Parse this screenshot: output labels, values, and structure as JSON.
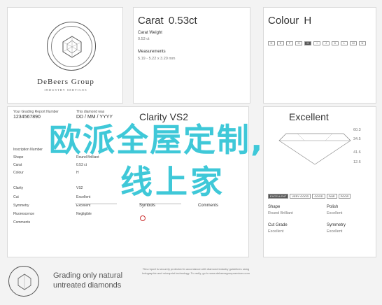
{
  "logo": {
    "brand_main": "DeBeers Group",
    "brand_sub": "INDUSTRY SERVICES"
  },
  "carat": {
    "title": "Carat",
    "value": "0.53ct",
    "weight_label": "Carat Weight",
    "weight_value": "0.53 ct",
    "measure_label": "Measurements",
    "measure_value": "5.19 - 5.22 x 3.20 mm"
  },
  "colour": {
    "title": "Colour",
    "value": "H",
    "scale": [
      "D",
      "E",
      "F",
      "G",
      "H",
      "I",
      "J",
      "K",
      "L",
      "M",
      "N"
    ]
  },
  "report": {
    "head_left": "Your Grading Report Number",
    "head_left_val": "1234567890",
    "head_right": "This diamond was",
    "date": "DD / MM / YYYY",
    "rows": [
      {
        "k": "Inscription Number",
        "v": "-"
      },
      {
        "k": "Shape",
        "v": "Round Brilliant"
      },
      {
        "k": "Carat",
        "v": "0.53 ct"
      },
      {
        "k": "Colour",
        "v": "H"
      },
      {
        "k": "Clarity",
        "v": "VS2"
      },
      {
        "k": "Cut",
        "v": "Excellent"
      },
      {
        "k": "Symmetry",
        "v": "Excellent"
      },
      {
        "k": "Fluorescence",
        "v": "Negligible"
      },
      {
        "k": "Comments",
        "v": ""
      }
    ],
    "clarity_title": "Clarity",
    "clarity_value": "VS2",
    "symbols": "Symbols",
    "comments": "Comments"
  },
  "right": {
    "cut_title": "Cut",
    "cut_value": "Excellent",
    "grades": [
      "EXCELLENT",
      "VERY GOOD",
      "GOOD",
      "FAIR",
      "POOR"
    ],
    "shape_label": "Shape",
    "shape_value": "Polish",
    "shape_sub": "Round Brilliant",
    "polish_sub": "Excellent",
    "cutgrade_label": "Cut Grade",
    "cutgrade_value": "Symmetry",
    "cutgrade_sub": "Excellent",
    "symmetry_sub": "Excellent",
    "proportions": [
      "60.3",
      "34.5",
      "41.6",
      "12.6"
    ]
  },
  "overlay": {
    "line1": "欧派全屋定制,",
    "line2": "线上家"
  },
  "bottom": {
    "title1": "Grading only natural",
    "title2": "untreated diamonds",
    "note": "This report is securely protected in accordance with diamond industry guidelines using holographic and microprint technology. To verify, go to www.debeersgroupservices.com"
  }
}
